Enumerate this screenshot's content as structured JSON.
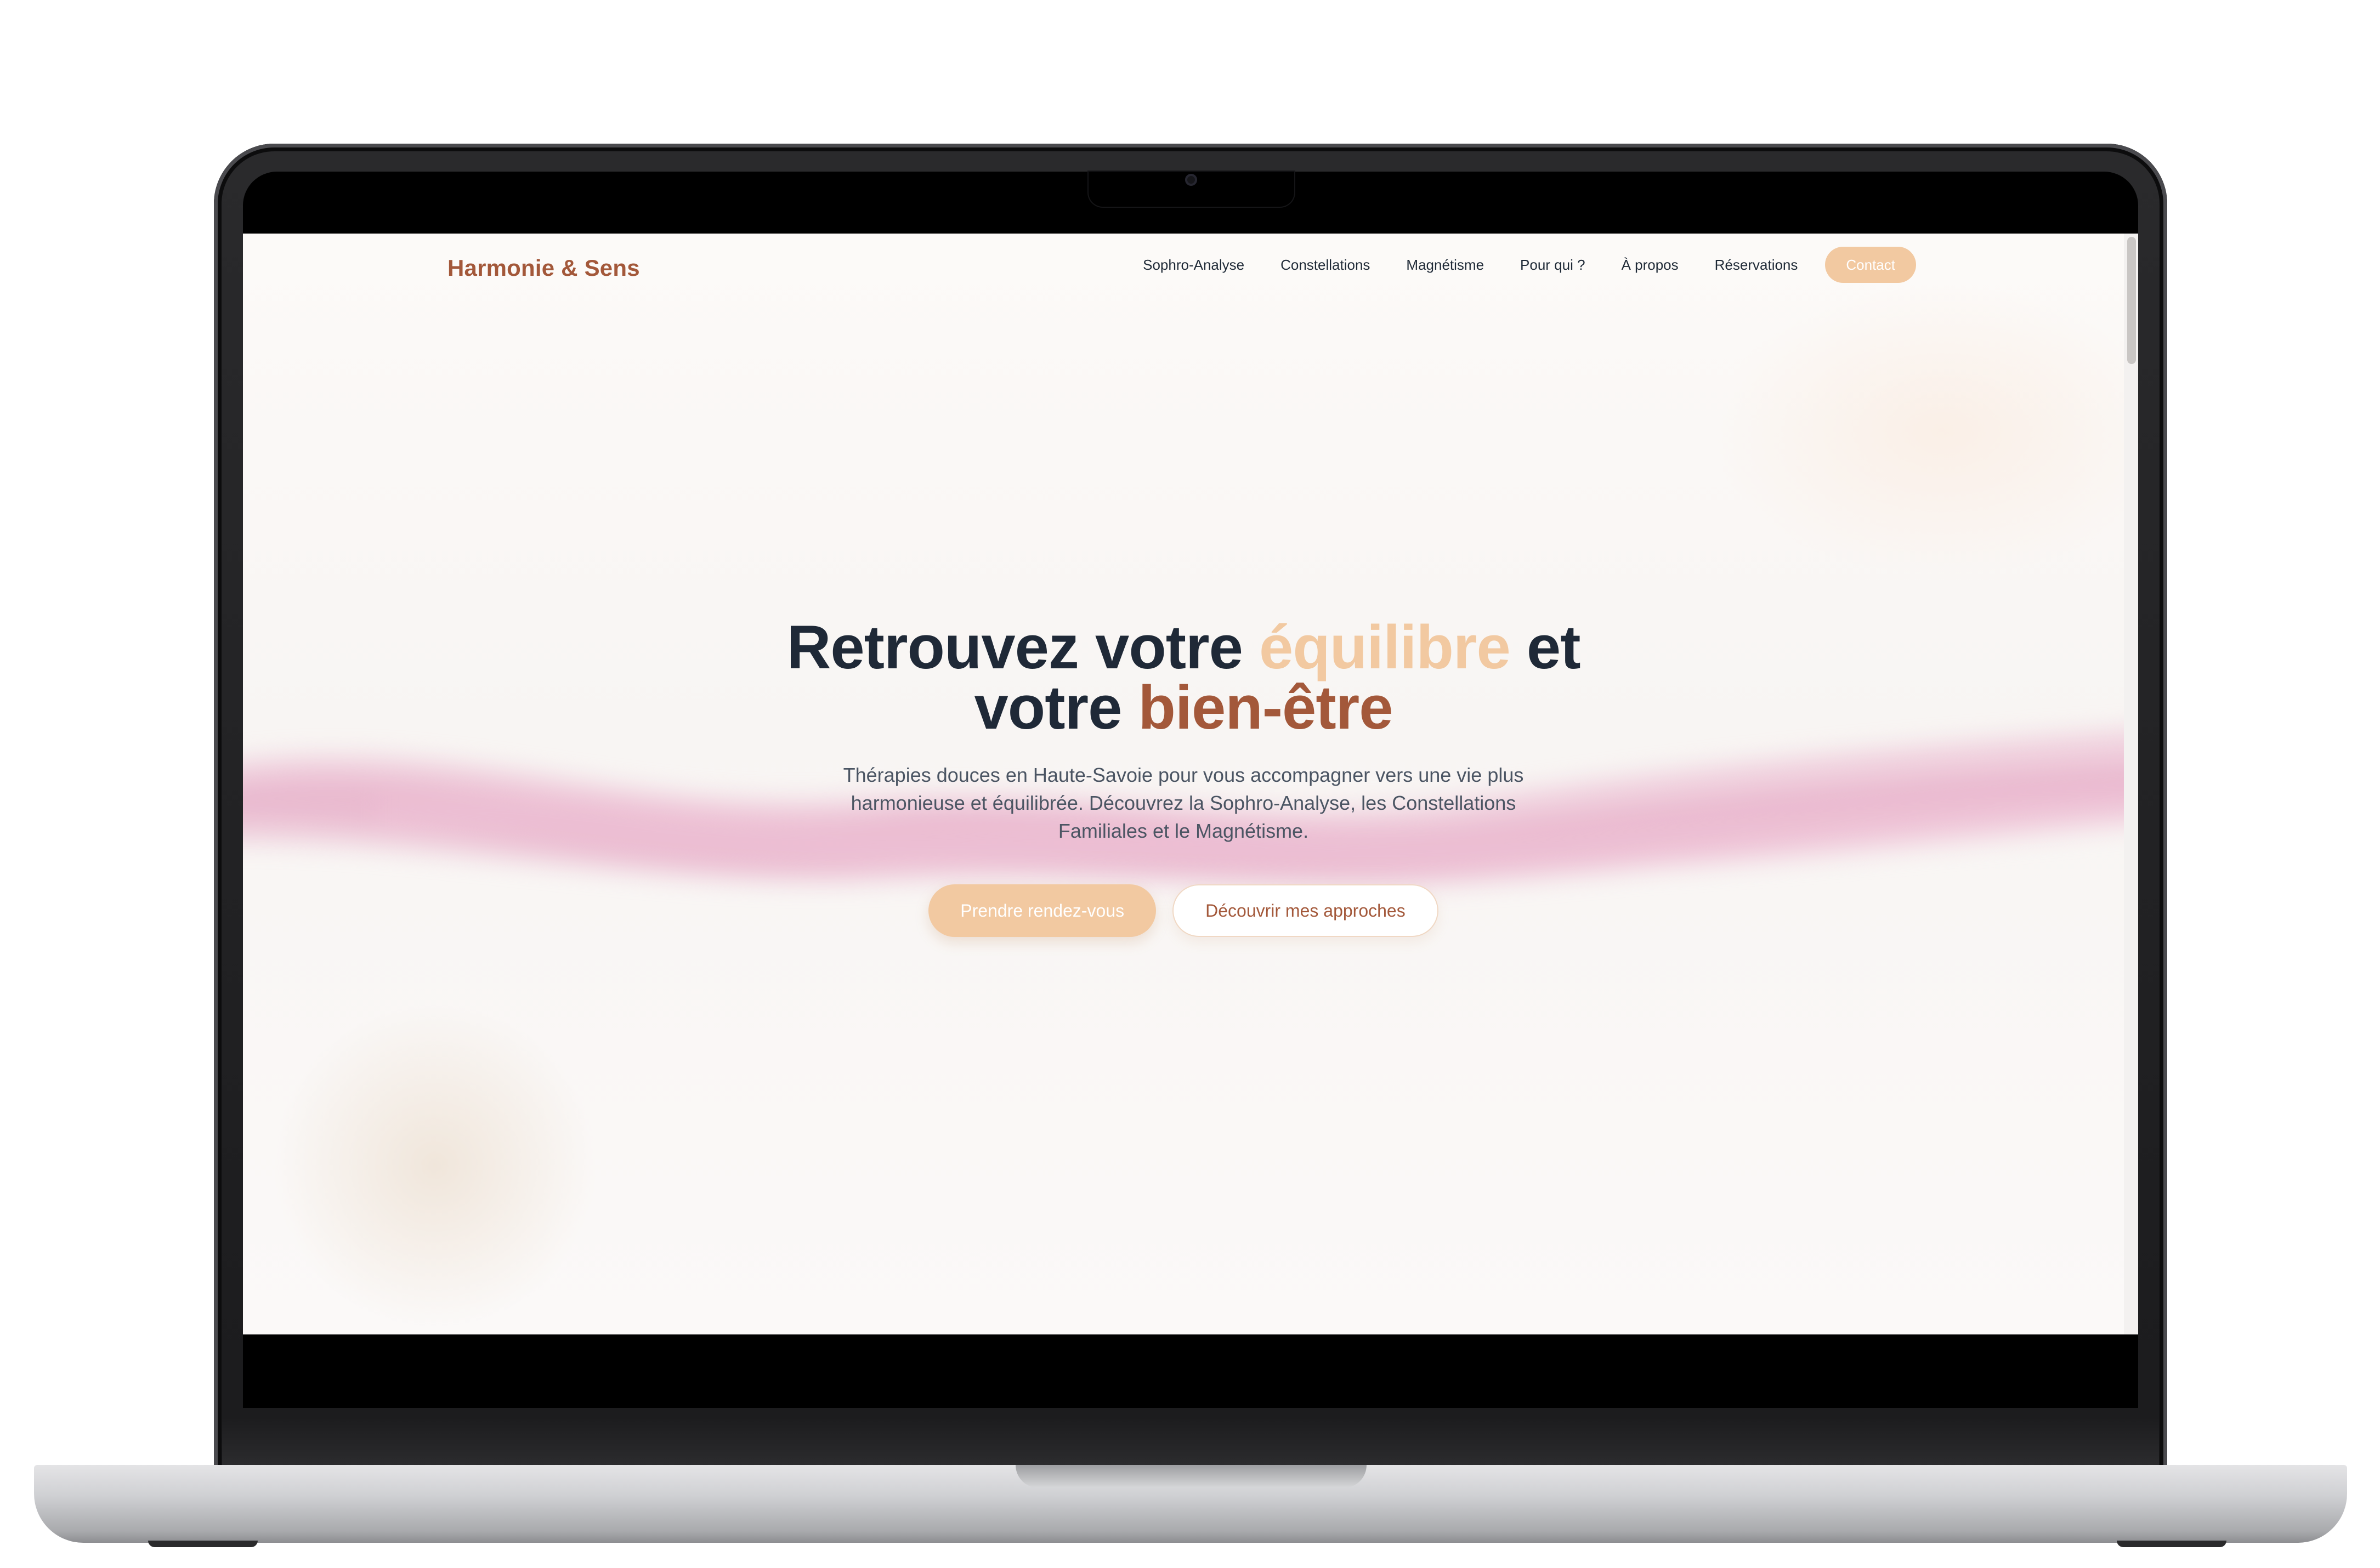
{
  "site": {
    "brand": "Harmonie & Sens",
    "nav": [
      {
        "label": "Sophro-Analyse"
      },
      {
        "label": "Constellations"
      },
      {
        "label": "Magnétisme"
      },
      {
        "label": "Pour qui ?"
      },
      {
        "label": "À propos"
      },
      {
        "label": "Réservations"
      }
    ],
    "contact_label": "Contact"
  },
  "hero": {
    "title_part1": "Retrouvez votre ",
    "title_accent1": "équilibre",
    "title_part2": " et",
    "title_part3": "votre ",
    "title_accent2": "bien-être",
    "subtitle": "Thérapies douces en Haute-Savoie pour vous accompagner vers une vie plus harmonieuse et équilibrée. Découvrez la Sophro-Analyse, les Constellations Familiales et le Magnétisme.",
    "primary_button": "Prendre rendez-vous",
    "secondary_button": "Découvrir mes approches"
  },
  "colors": {
    "brand": "#a3583a",
    "accent_light": "#f2c9a1",
    "text_dark": "#1f2937",
    "wave": "#e8a9c6"
  },
  "icons": {
    "camera": "camera-icon"
  }
}
